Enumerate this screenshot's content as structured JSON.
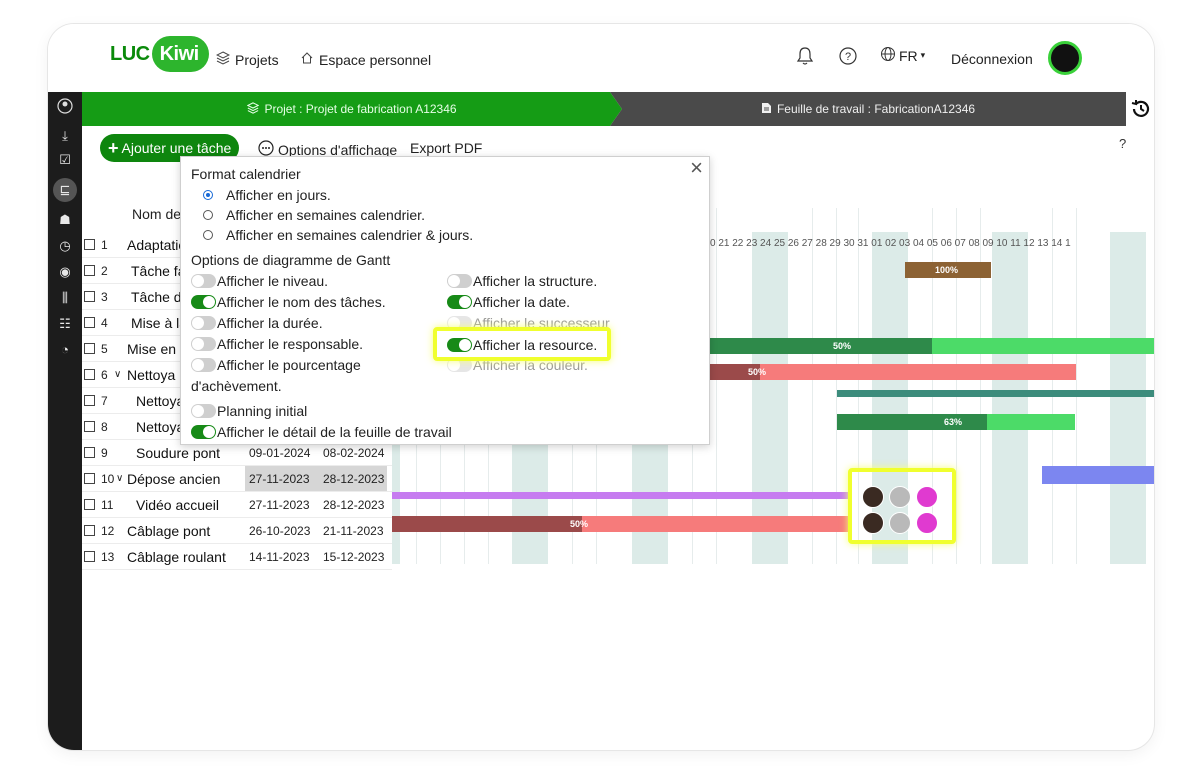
{
  "colors": {
    "brand_green": "#159c15",
    "dark_bar": "#4a4a4a",
    "highlight": "#f0ff2e",
    "green_bar": "#4cdb68",
    "dark_green_bar": "#2e8a4a",
    "red_bar": "#f67b7b",
    "dark_red_bar": "#9b4a4a",
    "purple_bar": "#c67cf0",
    "blue_bar": "#7c86f0",
    "brown_bar": "#8c6234",
    "teal_bar": "#3c8c7c"
  },
  "nav": {
    "logo_part1": "LUC",
    "logo_part2": "Kiwi",
    "projects_label": "Projets",
    "personal_space_label": "Espace personnel",
    "language": "FR",
    "logout": "Déconnexion"
  },
  "breadcrumb": {
    "project": "Projet : Projet de fabrication A12346",
    "worksheet": "Feuille de travail : FabricationA12346"
  },
  "toolbar": {
    "add_task": "Ajouter une tâche",
    "display_options": "Options d'affichage",
    "export_pdf": "Export PDF",
    "help": "?"
  },
  "table": {
    "name_header": "Nom de",
    "rows": [
      {
        "num": "1",
        "name": "Adaptatio",
        "start": "",
        "end": ""
      },
      {
        "num": "2",
        "name": "Tâche fa",
        "start": "",
        "end": ""
      },
      {
        "num": "3",
        "name": "Tâche d",
        "start": "",
        "end": ""
      },
      {
        "num": "4",
        "name": "Mise à la",
        "start": "",
        "end": ""
      },
      {
        "num": "5",
        "name": "Mise en p",
        "start": "",
        "end": ""
      },
      {
        "num": "6",
        "name": "Nettoya",
        "start": "",
        "end": ""
      },
      {
        "num": "7",
        "name": "Nettoya",
        "start": "",
        "end": ""
      },
      {
        "num": "8",
        "name": "Nettoya",
        "start": "",
        "end": ""
      },
      {
        "num": "9",
        "name": "Soudure pont",
        "start": "09-01-2024",
        "end": "08-02-2024"
      },
      {
        "num": "10",
        "name": "Dépose ancien",
        "start": "27-11-2023",
        "end": "28-12-2023"
      },
      {
        "num": "11",
        "name": "Vidéo accueil",
        "start": "27-11-2023",
        "end": "28-12-2023"
      },
      {
        "num": "12",
        "name": "Câblage pont",
        "start": "26-10-2023",
        "end": "21-11-2023"
      },
      {
        "num": "13",
        "name": "Câblage roulant",
        "start": "14-11-2023",
        "end": "15-12-2023"
      }
    ]
  },
  "timeline": {
    "days_label": "0 21 22 23 24 25 26 27 28 29 30 31 01 02 03 04 05 06 07 08 09 10 11 12 13 14 1"
  },
  "bars": {
    "row1_pct": "100%",
    "row4_pct": "50%",
    "row5_pct": "50%",
    "row7_pct": "63%",
    "row11_pct": "50%"
  },
  "popup": {
    "calendar_title": "Format calendrier",
    "radio_days": "Afficher en jours.",
    "radio_weeks": "Afficher en semaines calendrier.",
    "radio_weeks_days": "Afficher en semaines calendrier & jours.",
    "gantt_title": "Options de diagramme de Gantt",
    "show_level": "Afficher le niveau.",
    "show_task_name": "Afficher le nom des tâches.",
    "show_duration": "Afficher la durée.",
    "show_owner": "Afficher le responsable.",
    "show_percent": "Afficher le pourcentage",
    "show_percent_cont": "d'achèvement.",
    "initial_planning": "Planning initial",
    "show_worksheet_detail": "Afficher le détail de la feuille de travail",
    "show_structure": "Afficher la structure.",
    "show_date": "Afficher la date.",
    "show_successor": "Afficher le successeur",
    "show_resource": "Afficher la resource.",
    "show_color": "Afficher la couleur."
  }
}
